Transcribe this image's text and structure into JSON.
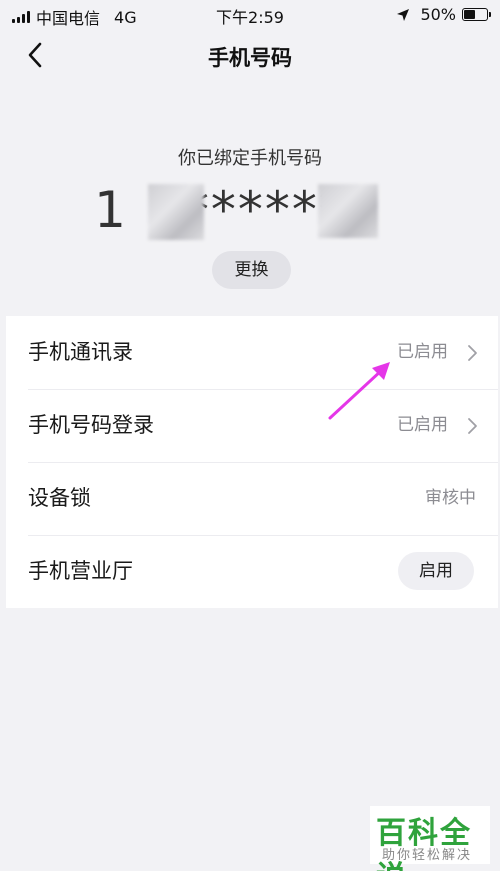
{
  "status_bar": {
    "carrier": "中国电信",
    "network": "4G",
    "time": "下午2:59",
    "battery": "50%",
    "battery_level": 0.5
  },
  "header": {
    "title": "手机号码"
  },
  "bound_phone": {
    "label": "你已绑定手机号码",
    "number_visible": "1",
    "number_mask": "******",
    "change_label": "更换"
  },
  "settings": {
    "items": [
      {
        "label": "手机通讯录",
        "value": "已启用"
      },
      {
        "label": "手机号码登录",
        "value": "已启用"
      },
      {
        "label": "设备锁",
        "value": "审核中"
      },
      {
        "label": "手机营业厅",
        "button": "启用"
      }
    ]
  },
  "watermark": {
    "title": "百科全说",
    "subtitle": "助你轻松解决"
  },
  "colors": {
    "background": "#f2f2f5",
    "annotation_arrow": "#e536e8",
    "watermark_green": "#2fa33c"
  }
}
